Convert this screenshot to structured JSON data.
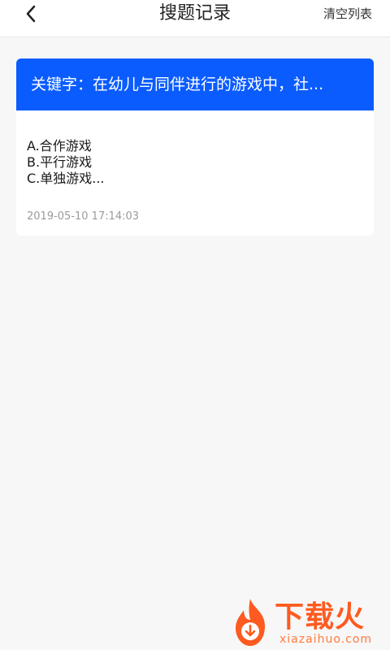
{
  "header": {
    "title": "搜题记录",
    "clear_label": "清空列表"
  },
  "records": [
    {
      "keyword": "关键字：在幼儿与同伴进行的游戏中，社...",
      "options": [
        "A.合作游戏",
        "B.平行游戏",
        "C.单独游戏..."
      ],
      "timestamp": "2019-05-10 17:14:03"
    }
  ],
  "watermark": {
    "brand": "下载火",
    "domain": "xiazaihuo.com"
  },
  "colors": {
    "accent": "#0a5cff",
    "background": "#f7f7f7",
    "watermark": "#ff5a1f"
  },
  "icons": [
    "back-arrow-icon",
    "flame-logo-icon"
  ]
}
